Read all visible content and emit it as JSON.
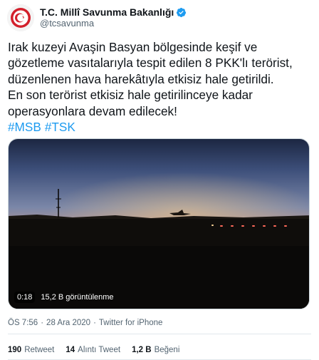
{
  "author": {
    "display_name": "T.C. Millî Savunma Bakanlığı",
    "handle": "@tcsavunma"
  },
  "tweet": {
    "lines": [
      "Irak kuzeyi Avaşin Basyan bölgesinde keşif ve",
      "gözetleme vasıtalarıyla tespit edilen 8 PKK'lı terörist,",
      "düzenlenen hava harekâtıyla etkisiz hale getirildi.",
      "En son terörist etkisiz hale getirilinceye kadar",
      "operasyonlara devam edilecek!"
    ],
    "hashtags": [
      "#MSB",
      "#TSK"
    ]
  },
  "video": {
    "duration": "0:18",
    "views": "15,2 B görüntülenme"
  },
  "meta": {
    "time": "ÖS 7:56",
    "date": "28 Ara 2020",
    "source": "Twitter for iPhone"
  },
  "stats": {
    "retweets_count": "190",
    "retweets_label": "Retweet",
    "quotes_count": "14",
    "quotes_label": "Alıntı Tweet",
    "likes_count": "1,2 B",
    "likes_label": "Beğeni"
  },
  "colors": {
    "link": "#1d9bf0",
    "verified": "#1d9bf0",
    "secondary_text": "#536471"
  },
  "icons": {
    "verified": "verified-badge-icon",
    "avatar": "msb-emblem-icon"
  }
}
